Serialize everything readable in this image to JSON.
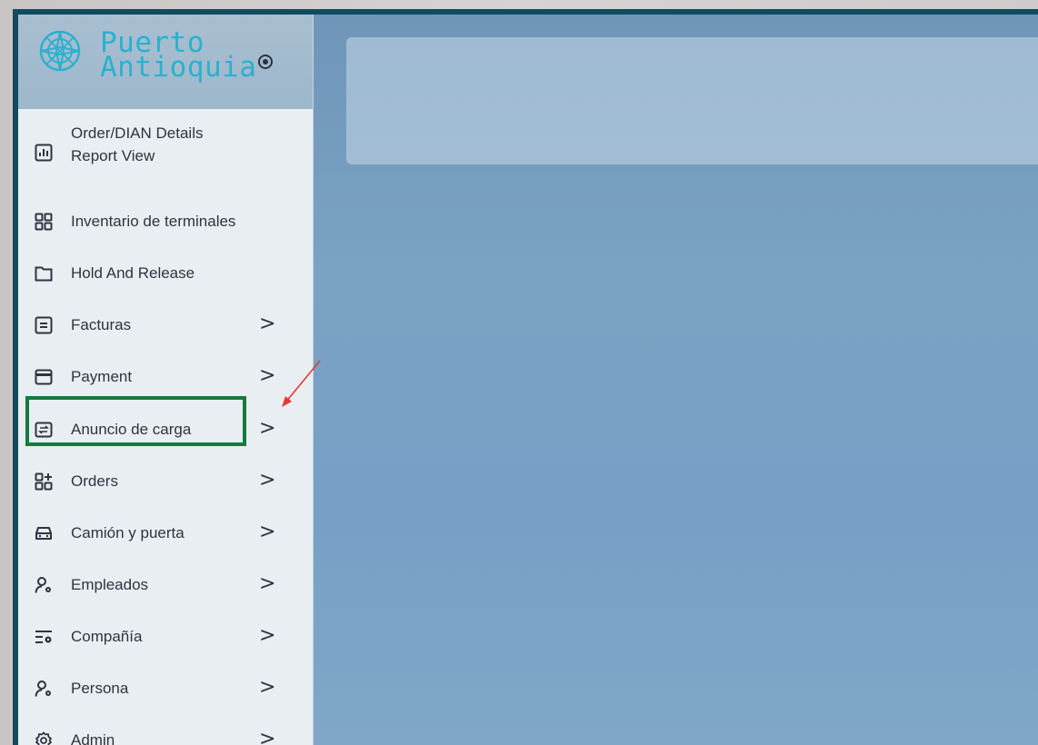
{
  "brand": {
    "title_line1": "Puerto",
    "title_line2": "Antioquia",
    "logo_icon": "compass-rose-icon",
    "toggle_icon": "radio-dot-icon",
    "title_color": "#2bb0cf"
  },
  "sidebar": {
    "items": [
      {
        "label": "Order/DIAN Details Report View",
        "icon": "bar-chart-icon",
        "has_submenu": false
      },
      {
        "label": "Inventario de terminales",
        "icon": "grid-icon",
        "has_submenu": false
      },
      {
        "label": "Hold And Release",
        "icon": "folder-icon",
        "has_submenu": false
      },
      {
        "label": "Facturas",
        "icon": "document-icon",
        "has_submenu": true
      },
      {
        "label": "Payment",
        "icon": "card-icon",
        "has_submenu": true
      },
      {
        "label": "Anuncio de carga",
        "icon": "transfer-icon",
        "has_submenu": true,
        "highlighted": true
      },
      {
        "label": "Orders",
        "icon": "grid-plus-icon",
        "has_submenu": true
      },
      {
        "label": "Camión y puerta",
        "icon": "car-icon",
        "has_submenu": true
      },
      {
        "label": "Empleados",
        "icon": "user-gear-icon",
        "has_submenu": true
      },
      {
        "label": "Compañía",
        "icon": "list-gear-icon",
        "has_submenu": true
      },
      {
        "label": "Persona",
        "icon": "user-gear-icon",
        "has_submenu": true
      },
      {
        "label": "Admin",
        "icon": "settings-icon",
        "has_submenu": true
      }
    ],
    "chevron": ">"
  },
  "colors": {
    "highlight_border": "#177a3c",
    "arrow": "#e53935",
    "frame": "#124a5e"
  }
}
